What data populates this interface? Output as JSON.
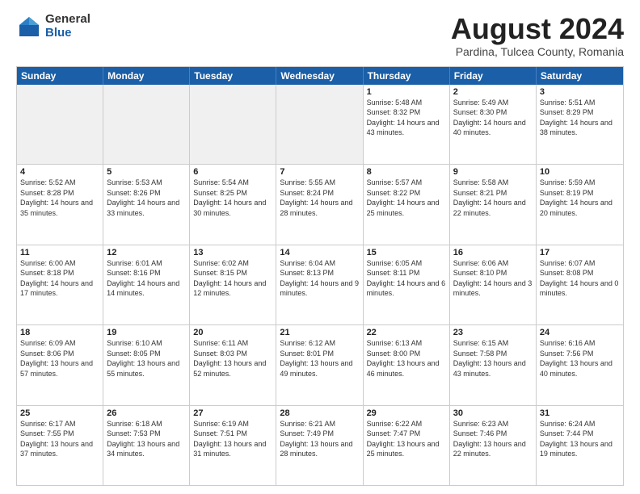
{
  "logo": {
    "general": "General",
    "blue": "Blue"
  },
  "header": {
    "month": "August 2024",
    "location": "Pardina, Tulcea County, Romania"
  },
  "weekdays": [
    "Sunday",
    "Monday",
    "Tuesday",
    "Wednesday",
    "Thursday",
    "Friday",
    "Saturday"
  ],
  "rows": [
    [
      {
        "day": "",
        "text": "",
        "shaded": true
      },
      {
        "day": "",
        "text": "",
        "shaded": true
      },
      {
        "day": "",
        "text": "",
        "shaded": true
      },
      {
        "day": "",
        "text": "",
        "shaded": true
      },
      {
        "day": "1",
        "text": "Sunrise: 5:48 AM\nSunset: 8:32 PM\nDaylight: 14 hours and 43 minutes."
      },
      {
        "day": "2",
        "text": "Sunrise: 5:49 AM\nSunset: 8:30 PM\nDaylight: 14 hours and 40 minutes."
      },
      {
        "day": "3",
        "text": "Sunrise: 5:51 AM\nSunset: 8:29 PM\nDaylight: 14 hours and 38 minutes."
      }
    ],
    [
      {
        "day": "4",
        "text": "Sunrise: 5:52 AM\nSunset: 8:28 PM\nDaylight: 14 hours and 35 minutes."
      },
      {
        "day": "5",
        "text": "Sunrise: 5:53 AM\nSunset: 8:26 PM\nDaylight: 14 hours and 33 minutes."
      },
      {
        "day": "6",
        "text": "Sunrise: 5:54 AM\nSunset: 8:25 PM\nDaylight: 14 hours and 30 minutes."
      },
      {
        "day": "7",
        "text": "Sunrise: 5:55 AM\nSunset: 8:24 PM\nDaylight: 14 hours and 28 minutes."
      },
      {
        "day": "8",
        "text": "Sunrise: 5:57 AM\nSunset: 8:22 PM\nDaylight: 14 hours and 25 minutes."
      },
      {
        "day": "9",
        "text": "Sunrise: 5:58 AM\nSunset: 8:21 PM\nDaylight: 14 hours and 22 minutes."
      },
      {
        "day": "10",
        "text": "Sunrise: 5:59 AM\nSunset: 8:19 PM\nDaylight: 14 hours and 20 minutes."
      }
    ],
    [
      {
        "day": "11",
        "text": "Sunrise: 6:00 AM\nSunset: 8:18 PM\nDaylight: 14 hours and 17 minutes."
      },
      {
        "day": "12",
        "text": "Sunrise: 6:01 AM\nSunset: 8:16 PM\nDaylight: 14 hours and 14 minutes."
      },
      {
        "day": "13",
        "text": "Sunrise: 6:02 AM\nSunset: 8:15 PM\nDaylight: 14 hours and 12 minutes."
      },
      {
        "day": "14",
        "text": "Sunrise: 6:04 AM\nSunset: 8:13 PM\nDaylight: 14 hours and 9 minutes."
      },
      {
        "day": "15",
        "text": "Sunrise: 6:05 AM\nSunset: 8:11 PM\nDaylight: 14 hours and 6 minutes."
      },
      {
        "day": "16",
        "text": "Sunrise: 6:06 AM\nSunset: 8:10 PM\nDaylight: 14 hours and 3 minutes."
      },
      {
        "day": "17",
        "text": "Sunrise: 6:07 AM\nSunset: 8:08 PM\nDaylight: 14 hours and 0 minutes."
      }
    ],
    [
      {
        "day": "18",
        "text": "Sunrise: 6:09 AM\nSunset: 8:06 PM\nDaylight: 13 hours and 57 minutes."
      },
      {
        "day": "19",
        "text": "Sunrise: 6:10 AM\nSunset: 8:05 PM\nDaylight: 13 hours and 55 minutes."
      },
      {
        "day": "20",
        "text": "Sunrise: 6:11 AM\nSunset: 8:03 PM\nDaylight: 13 hours and 52 minutes."
      },
      {
        "day": "21",
        "text": "Sunrise: 6:12 AM\nSunset: 8:01 PM\nDaylight: 13 hours and 49 minutes."
      },
      {
        "day": "22",
        "text": "Sunrise: 6:13 AM\nSunset: 8:00 PM\nDaylight: 13 hours and 46 minutes."
      },
      {
        "day": "23",
        "text": "Sunrise: 6:15 AM\nSunset: 7:58 PM\nDaylight: 13 hours and 43 minutes."
      },
      {
        "day": "24",
        "text": "Sunrise: 6:16 AM\nSunset: 7:56 PM\nDaylight: 13 hours and 40 minutes."
      }
    ],
    [
      {
        "day": "25",
        "text": "Sunrise: 6:17 AM\nSunset: 7:55 PM\nDaylight: 13 hours and 37 minutes."
      },
      {
        "day": "26",
        "text": "Sunrise: 6:18 AM\nSunset: 7:53 PM\nDaylight: 13 hours and 34 minutes."
      },
      {
        "day": "27",
        "text": "Sunrise: 6:19 AM\nSunset: 7:51 PM\nDaylight: 13 hours and 31 minutes."
      },
      {
        "day": "28",
        "text": "Sunrise: 6:21 AM\nSunset: 7:49 PM\nDaylight: 13 hours and 28 minutes."
      },
      {
        "day": "29",
        "text": "Sunrise: 6:22 AM\nSunset: 7:47 PM\nDaylight: 13 hours and 25 minutes."
      },
      {
        "day": "30",
        "text": "Sunrise: 6:23 AM\nSunset: 7:46 PM\nDaylight: 13 hours and 22 minutes."
      },
      {
        "day": "31",
        "text": "Sunrise: 6:24 AM\nSunset: 7:44 PM\nDaylight: 13 hours and 19 minutes."
      }
    ]
  ]
}
